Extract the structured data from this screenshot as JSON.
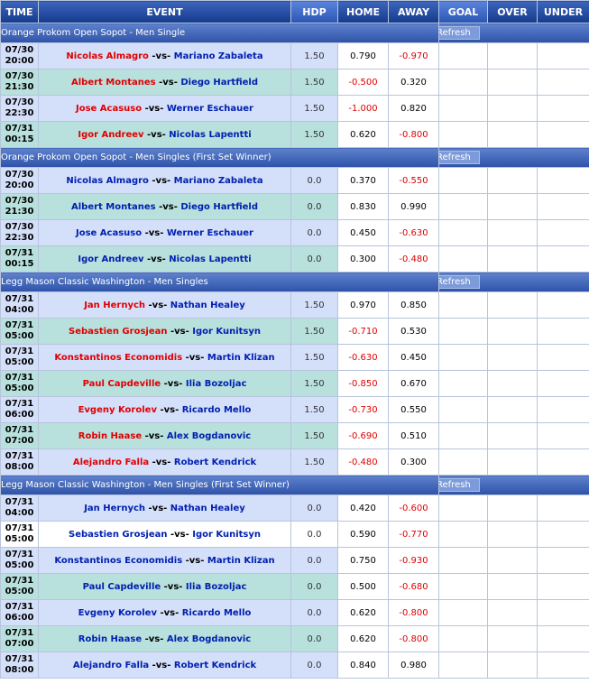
{
  "header": [
    "TIME",
    "EVENT",
    "HDP",
    "HOME",
    "AWAY",
    "GOAL",
    "OVER",
    "UNDER"
  ],
  "refresh_label": "Refresh",
  "sections": [
    {
      "title": "Orange Prokom Open Sopot - Men Single",
      "rows": [
        {
          "date": "07/30",
          "time": "20:00",
          "home": "Nicolas Almagro",
          "away": "Mariano Zabaleta",
          "fav": "home",
          "hdp": "1.50",
          "home_odds": "0.790",
          "away_odds": "-0.970",
          "bg": "a"
        },
        {
          "date": "07/30",
          "time": "21:30",
          "home": "Albert Montanes",
          "away": "Diego Hartfield",
          "fav": "home",
          "hdp": "1.50",
          "home_odds": "-0.500",
          "away_odds": "0.320",
          "bg": "b"
        },
        {
          "date": "07/30",
          "time": "22:30",
          "home": "Jose Acasuso",
          "away": "Werner Eschauer",
          "fav": "home",
          "hdp": "1.50",
          "home_odds": "-1.000",
          "away_odds": "0.820",
          "bg": "a"
        },
        {
          "date": "07/31",
          "time": "00:15",
          "home": "Igor Andreev",
          "away": "Nicolas Lapentti",
          "fav": "home",
          "hdp": "1.50",
          "home_odds": "0.620",
          "away_odds": "-0.800",
          "bg": "b"
        }
      ]
    },
    {
      "title": "Orange Prokom Open Sopot - Men Singles (First Set Winner)",
      "rows": [
        {
          "date": "07/30",
          "time": "20:00",
          "home": "Nicolas Almagro",
          "away": "Mariano Zabaleta",
          "fav": "none",
          "hdp": "0.0",
          "home_odds": "0.370",
          "away_odds": "-0.550",
          "bg": "a"
        },
        {
          "date": "07/30",
          "time": "21:30",
          "home": "Albert Montanes",
          "away": "Diego Hartfield",
          "fav": "none",
          "hdp": "0.0",
          "home_odds": "0.830",
          "away_odds": "0.990",
          "bg": "b"
        },
        {
          "date": "07/30",
          "time": "22:30",
          "home": "Jose Acasuso",
          "away": "Werner Eschauer",
          "fav": "none",
          "hdp": "0.0",
          "home_odds": "0.450",
          "away_odds": "-0.630",
          "bg": "a"
        },
        {
          "date": "07/31",
          "time": "00:15",
          "home": "Igor Andreev",
          "away": "Nicolas Lapentti",
          "fav": "none",
          "hdp": "0.0",
          "home_odds": "0.300",
          "away_odds": "-0.480",
          "bg": "b"
        }
      ]
    },
    {
      "title": "Legg Mason Classic Washington - Men Singles",
      "rows": [
        {
          "date": "07/31",
          "time": "04:00",
          "home": "Jan Hernych",
          "away": "Nathan Healey",
          "fav": "home",
          "hdp": "1.50",
          "home_odds": "0.970",
          "away_odds": "0.850",
          "bg": "a"
        },
        {
          "date": "07/31",
          "time": "05:00",
          "home": "Sebastien Grosjean",
          "away": "Igor Kunitsyn",
          "fav": "home",
          "hdp": "1.50",
          "home_odds": "-0.710",
          "away_odds": "0.530",
          "bg": "b"
        },
        {
          "date": "07/31",
          "time": "05:00",
          "home": "Konstantinos Economidis",
          "away": "Martin Klizan",
          "fav": "home",
          "hdp": "1.50",
          "home_odds": "-0.630",
          "away_odds": "0.450",
          "bg": "a"
        },
        {
          "date": "07/31",
          "time": "05:00",
          "home": "Paul Capdeville",
          "away": "Ilia Bozoljac",
          "fav": "home",
          "hdp": "1.50",
          "home_odds": "-0.850",
          "away_odds": "0.670",
          "bg": "b"
        },
        {
          "date": "07/31",
          "time": "06:00",
          "home": "Evgeny Korolev",
          "away": "Ricardo Mello",
          "fav": "home",
          "hdp": "1.50",
          "home_odds": "-0.730",
          "away_odds": "0.550",
          "bg": "a"
        },
        {
          "date": "07/31",
          "time": "07:00",
          "home": "Robin Haase",
          "away": "Alex Bogdanovic",
          "fav": "home",
          "hdp": "1.50",
          "home_odds": "-0.690",
          "away_odds": "0.510",
          "bg": "b"
        },
        {
          "date": "07/31",
          "time": "08:00",
          "home": "Alejandro Falla",
          "away": "Robert Kendrick",
          "fav": "home",
          "hdp": "1.50",
          "home_odds": "-0.480",
          "away_odds": "0.300",
          "bg": "a"
        }
      ]
    },
    {
      "title": "Legg Mason Classic Washington - Men Singles (First Set Winner)",
      "rows": [
        {
          "date": "07/31",
          "time": "04:00",
          "home": "Jan Hernych",
          "away": "Nathan Healey",
          "fav": "none",
          "hdp": "0.0",
          "home_odds": "0.420",
          "away_odds": "-0.600",
          "bg": "a"
        },
        {
          "date": "07/31",
          "time": "05:00",
          "home": "Sebastien Grosjean",
          "away": "Igor Kunitsyn",
          "fav": "none",
          "hdp": "0.0",
          "home_odds": "0.590",
          "away_odds": "-0.770",
          "bg": "w"
        },
        {
          "date": "07/31",
          "time": "05:00",
          "home": "Konstantinos Economidis",
          "away": "Martin Klizan",
          "fav": "none",
          "hdp": "0.0",
          "home_odds": "0.750",
          "away_odds": "-0.930",
          "bg": "a"
        },
        {
          "date": "07/31",
          "time": "05:00",
          "home": "Paul Capdeville",
          "away": "Ilia Bozoljac",
          "fav": "none",
          "hdp": "0.0",
          "home_odds": "0.500",
          "away_odds": "-0.680",
          "bg": "b"
        },
        {
          "date": "07/31",
          "time": "06:00",
          "home": "Evgeny Korolev",
          "away": "Ricardo Mello",
          "fav": "none",
          "hdp": "0.0",
          "home_odds": "0.620",
          "away_odds": "-0.800",
          "bg": "a"
        },
        {
          "date": "07/31",
          "time": "07:00",
          "home": "Robin Haase",
          "away": "Alex Bogdanovic",
          "fav": "none",
          "hdp": "0.0",
          "home_odds": "0.620",
          "away_odds": "-0.800",
          "bg": "b"
        },
        {
          "date": "07/31",
          "time": "08:00",
          "home": "Alejandro Falla",
          "away": "Robert Kendrick",
          "fav": "none",
          "hdp": "0.0",
          "home_odds": "0.840",
          "away_odds": "0.980",
          "bg": "a"
        }
      ]
    }
  ],
  "colors": {
    "header_blue": "#143a8c",
    "row_blue": "#d4dffa",
    "row_teal": "#b8e0dc",
    "negative_red": "#e00000",
    "favorite_red": "#e00000",
    "underdog_blue": "#0020b0"
  }
}
